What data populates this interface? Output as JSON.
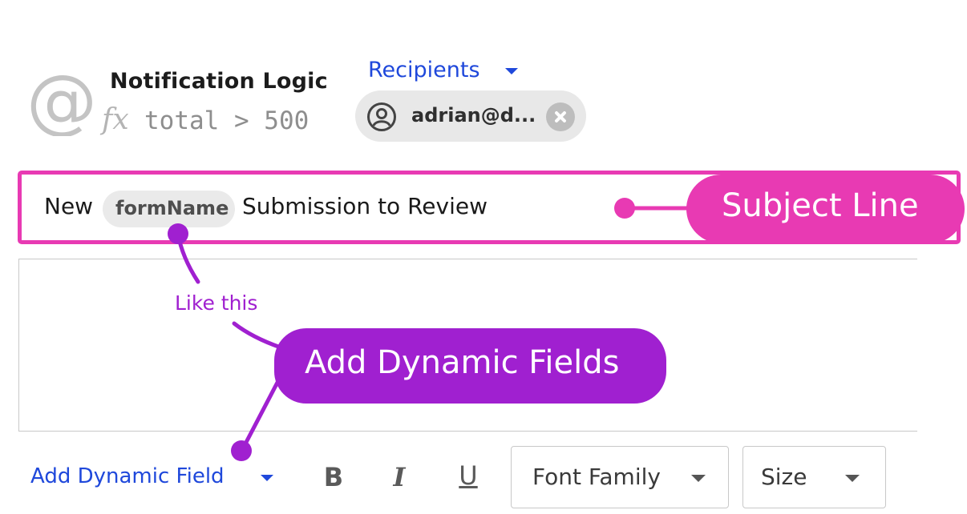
{
  "header": {
    "title": "Notification Logic",
    "formula_prefix": "fx",
    "formula": "total > 500",
    "icon": "at-sign-icon"
  },
  "recipients": {
    "label": "Recipients",
    "chips": [
      {
        "text": "adrian@d...",
        "icon": "user-circle-icon"
      }
    ]
  },
  "subject": {
    "parts": {
      "prefix": "New",
      "token": "formName",
      "suffix": "Submission to Review"
    }
  },
  "callouts": {
    "subject_line": "Subject Line",
    "like_this": "Like this",
    "add_dynamic_fields": "Add Dynamic Fields"
  },
  "toolbar": {
    "add_dynamic_field": "Add Dynamic Field",
    "bold": "B",
    "italic": "I",
    "underline": "U",
    "font_family": "Font Family",
    "size": "Size"
  },
  "colors": {
    "accent_blue": "#1f48db",
    "pink": "#e83ab3",
    "purple": "#a020d0"
  }
}
